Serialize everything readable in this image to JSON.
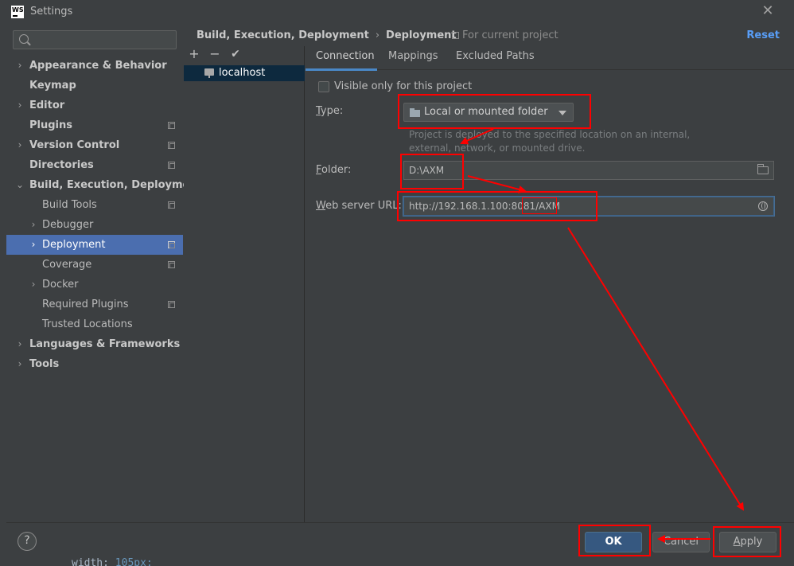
{
  "window": {
    "title": "Settings",
    "logo_text": "WS",
    "close_glyph": "✕"
  },
  "search": {
    "placeholder": ""
  },
  "sidebar": {
    "items": [
      {
        "label": "Appearance & Behavior",
        "chevron": "›"
      },
      {
        "label": "Keymap"
      },
      {
        "label": "Editor",
        "chevron": "›"
      },
      {
        "label": "Plugins"
      },
      {
        "label": "Version Control",
        "chevron": "›"
      },
      {
        "label": "Directories"
      },
      {
        "label": "Build, Execution, Deployment",
        "chevron": "⌄"
      },
      {
        "label": "Build Tools"
      },
      {
        "label": "Debugger",
        "chevron": "›"
      },
      {
        "label": "Deployment",
        "chevron": "›"
      },
      {
        "label": "Coverage"
      },
      {
        "label": "Docker",
        "chevron": "›"
      },
      {
        "label": "Required Plugins"
      },
      {
        "label": "Trusted Locations"
      },
      {
        "label": "Languages & Frameworks",
        "chevron": "›"
      },
      {
        "label": "Tools",
        "chevron": "›"
      }
    ]
  },
  "header": {
    "breadcrumb_parent": "Build, Execution, Deployment",
    "breadcrumb_sep": "›",
    "breadcrumb_current": "Deployment",
    "scope_label": "For current project",
    "reset_label": "Reset"
  },
  "servers": {
    "toolbar": {
      "add": "+",
      "remove": "−",
      "apply": "✔"
    },
    "items": [
      {
        "name": "localhost"
      }
    ]
  },
  "tabs": [
    {
      "label": "Connection"
    },
    {
      "label": "Mappings"
    },
    {
      "label": "Excluded Paths"
    }
  ],
  "form": {
    "visible_only_label": "Visible only for this project",
    "type_label_mn": "T",
    "type_label_rest": "ype:",
    "type_value": "Local or mounted folder",
    "type_hint": "Project is deployed to the specified location on an internal, external, network, or mounted drive.",
    "folder_label_mn": "F",
    "folder_label_rest": "older:",
    "folder_value": "D:\\AXM",
    "url_label_mn": "W",
    "url_label_rest": "eb server URL:",
    "url_value": "http://192.168.1.100:8081/AXM"
  },
  "footer": {
    "help": "?",
    "ok": "OK",
    "cancel": "Cancel",
    "apply_mn": "A",
    "apply_rest": "pply"
  },
  "code_peek": {
    "prop": "width: ",
    "num": "105",
    "unit": "px;"
  },
  "colors": {
    "selection": "#4b6eaf",
    "accent_link": "#589df6",
    "annotation": "#ff0000",
    "primary_button": "#365880"
  }
}
